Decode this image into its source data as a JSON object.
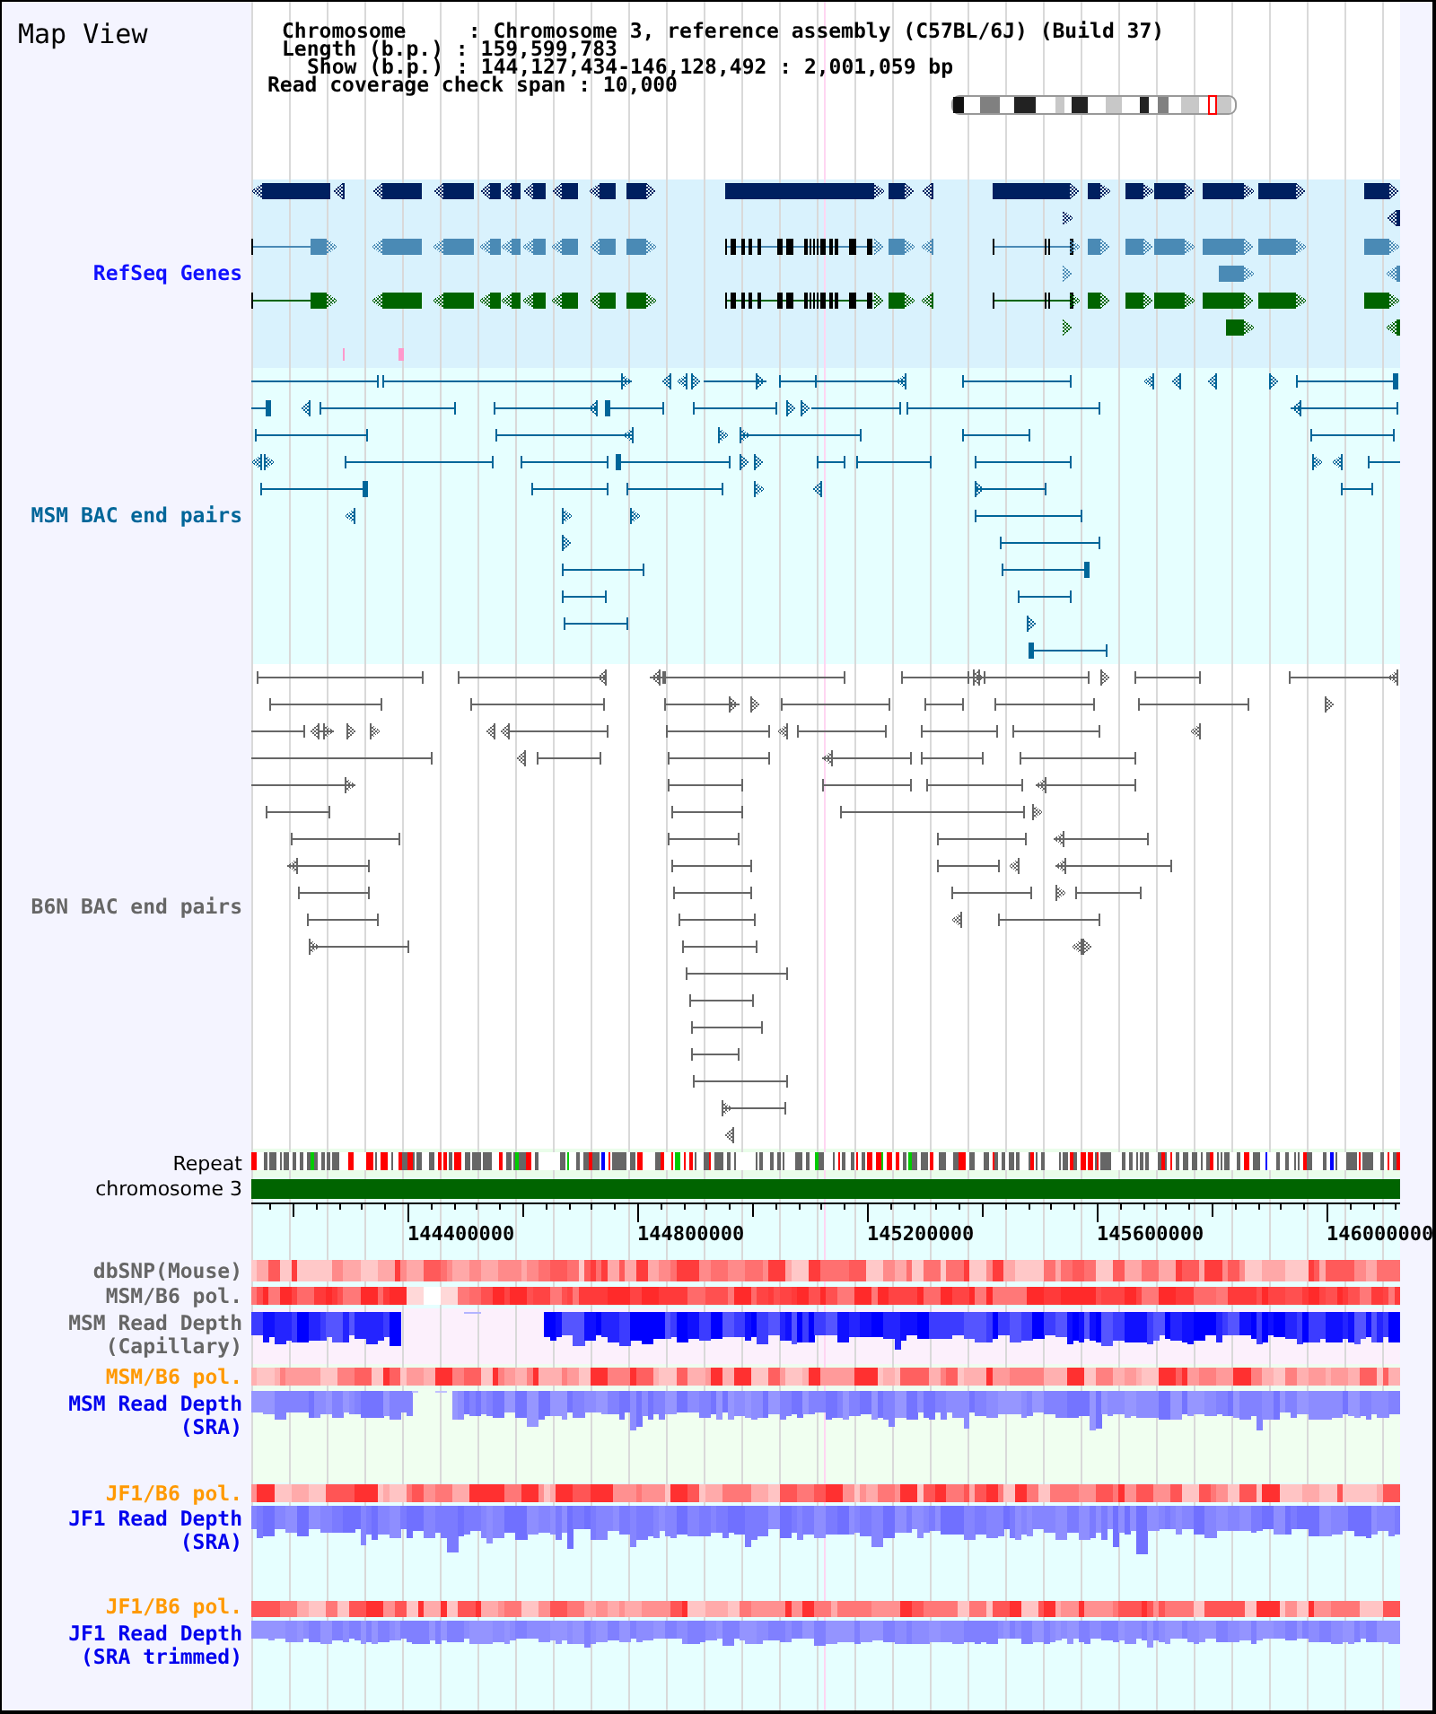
{
  "title": "Map View",
  "info_lines": [
    "Chromosome     : Chromosome 3, reference assembly (C57BL/6J) (Build 37)",
    "Length (b.p.) : 159,599,783",
    "Show (b.p.) : 144,127,434-146,128,492 : 2,001,059 bp",
    "Read coverage check span : 10,000"
  ],
  "tracks": [
    {
      "kind": "genes",
      "label": "RefSeq Genes",
      "color": "#1010ff"
    },
    {
      "kind": "bac_pairs",
      "label": "MSM BAC end pairs",
      "color": "#006699"
    },
    {
      "kind": "bac_pairs",
      "label": "B6N BAC end pairs",
      "color": "#666666"
    },
    {
      "kind": "repeat",
      "label": "Repeat",
      "color": "#000000"
    },
    {
      "kind": "chromosome",
      "label": "chromosome 3",
      "color": "#000000"
    },
    {
      "kind": "ruler",
      "ticks": [
        "144400000",
        "144800000",
        "145200000",
        "145600000",
        "146000000"
      ]
    },
    {
      "kind": "snp",
      "label": "dbSNP(Mouse)",
      "color": "#666666"
    },
    {
      "kind": "polymorphism",
      "label": "MSM/B6 pol.",
      "color": "#666666"
    },
    {
      "kind": "depth",
      "label": "MSM Read Depth (Capillary)",
      "color": "#666666"
    },
    {
      "kind": "polymorphism",
      "label": "MSM/B6 pol.",
      "color": "#ff9900"
    },
    {
      "kind": "depth",
      "label": "MSM Read Depth (SRA)",
      "color": "#0000ee"
    },
    {
      "kind": "polymorphism",
      "label": "JF1/B6 pol.",
      "color": "#ff9900"
    },
    {
      "kind": "depth",
      "label": "JF1 Read Depth (SRA)",
      "color": "#0000ee"
    },
    {
      "kind": "polymorphism",
      "label": "JF1/B6 pol.",
      "color": "#ff9900"
    },
    {
      "kind": "depth",
      "label": "JF1 Read Depth (SRA trimmed)",
      "color": "#0000ee"
    }
  ]
}
